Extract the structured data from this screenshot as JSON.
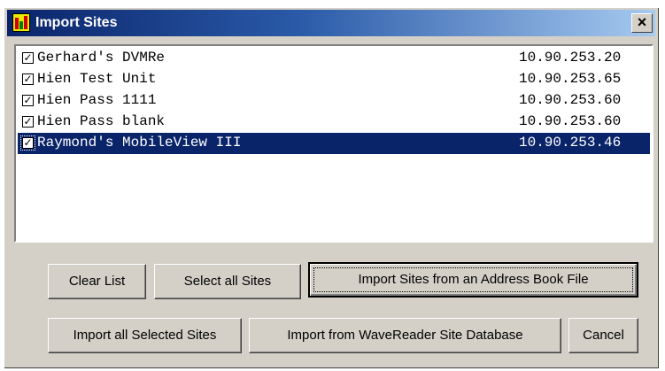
{
  "window": {
    "title": "Import Sites",
    "close_label": "×"
  },
  "sites": [
    {
      "name": "Gerhard's DVMRe",
      "ip": "10.90.253.20",
      "checked": true,
      "selected": false
    },
    {
      "name": "Hien Test Unit",
      "ip": "10.90.253.65",
      "checked": true,
      "selected": false
    },
    {
      "name": "Hien Pass 1111",
      "ip": "10.90.253.60",
      "checked": true,
      "selected": false
    },
    {
      "name": "Hien Pass blank",
      "ip": "10.90.253.60",
      "checked": true,
      "selected": false
    },
    {
      "name": "Raymond's MobileView III",
      "ip": "10.90.253.46",
      "checked": true,
      "selected": true
    }
  ],
  "buttons": {
    "clear_list": "Clear List",
    "select_all": "Select all Sites",
    "import_address_book": "Import Sites from an Address Book File",
    "import_selected": "Import all Selected Sites",
    "import_wavereader": "Import from WaveReader Site Database",
    "cancel": "Cancel"
  },
  "colors": {
    "selection": "#0a246a",
    "dialog_face": "#d4d0c8"
  }
}
